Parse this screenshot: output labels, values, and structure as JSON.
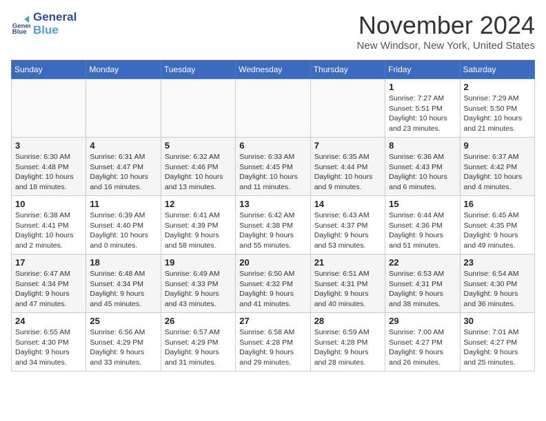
{
  "logo": {
    "line1": "General",
    "line2": "Blue"
  },
  "header": {
    "month": "November 2024",
    "location": "New Windsor, New York, United States"
  },
  "days_of_week": [
    "Sunday",
    "Monday",
    "Tuesday",
    "Wednesday",
    "Thursday",
    "Friday",
    "Saturday"
  ],
  "weeks": [
    [
      {
        "day": "",
        "info": ""
      },
      {
        "day": "",
        "info": ""
      },
      {
        "day": "",
        "info": ""
      },
      {
        "day": "",
        "info": ""
      },
      {
        "day": "",
        "info": ""
      },
      {
        "day": "1",
        "info": "Sunrise: 7:27 AM\nSunset: 5:51 PM\nDaylight: 10 hours and 23 minutes."
      },
      {
        "day": "2",
        "info": "Sunrise: 7:29 AM\nSunset: 5:50 PM\nDaylight: 10 hours and 21 minutes."
      }
    ],
    [
      {
        "day": "3",
        "info": "Sunrise: 6:30 AM\nSunset: 4:48 PM\nDaylight: 10 hours and 18 minutes."
      },
      {
        "day": "4",
        "info": "Sunrise: 6:31 AM\nSunset: 4:47 PM\nDaylight: 10 hours and 16 minutes."
      },
      {
        "day": "5",
        "info": "Sunrise: 6:32 AM\nSunset: 4:46 PM\nDaylight: 10 hours and 13 minutes."
      },
      {
        "day": "6",
        "info": "Sunrise: 6:33 AM\nSunset: 4:45 PM\nDaylight: 10 hours and 11 minutes."
      },
      {
        "day": "7",
        "info": "Sunrise: 6:35 AM\nSunset: 4:44 PM\nDaylight: 10 hours and 9 minutes."
      },
      {
        "day": "8",
        "info": "Sunrise: 6:36 AM\nSunset: 4:43 PM\nDaylight: 10 hours and 6 minutes."
      },
      {
        "day": "9",
        "info": "Sunrise: 6:37 AM\nSunset: 4:42 PM\nDaylight: 10 hours and 4 minutes."
      }
    ],
    [
      {
        "day": "10",
        "info": "Sunrise: 6:38 AM\nSunset: 4:41 PM\nDaylight: 10 hours and 2 minutes."
      },
      {
        "day": "11",
        "info": "Sunrise: 6:39 AM\nSunset: 4:40 PM\nDaylight: 10 hours and 0 minutes."
      },
      {
        "day": "12",
        "info": "Sunrise: 6:41 AM\nSunset: 4:39 PM\nDaylight: 9 hours and 58 minutes."
      },
      {
        "day": "13",
        "info": "Sunrise: 6:42 AM\nSunset: 4:38 PM\nDaylight: 9 hours and 55 minutes."
      },
      {
        "day": "14",
        "info": "Sunrise: 6:43 AM\nSunset: 4:37 PM\nDaylight: 9 hours and 53 minutes."
      },
      {
        "day": "15",
        "info": "Sunrise: 6:44 AM\nSunset: 4:36 PM\nDaylight: 9 hours and 51 minutes."
      },
      {
        "day": "16",
        "info": "Sunrise: 6:45 AM\nSunset: 4:35 PM\nDaylight: 9 hours and 49 minutes."
      }
    ],
    [
      {
        "day": "17",
        "info": "Sunrise: 6:47 AM\nSunset: 4:34 PM\nDaylight: 9 hours and 47 minutes."
      },
      {
        "day": "18",
        "info": "Sunrise: 6:48 AM\nSunset: 4:34 PM\nDaylight: 9 hours and 45 minutes."
      },
      {
        "day": "19",
        "info": "Sunrise: 6:49 AM\nSunset: 4:33 PM\nDaylight: 9 hours and 43 minutes."
      },
      {
        "day": "20",
        "info": "Sunrise: 6:50 AM\nSunset: 4:32 PM\nDaylight: 9 hours and 41 minutes."
      },
      {
        "day": "21",
        "info": "Sunrise: 6:51 AM\nSunset: 4:31 PM\nDaylight: 9 hours and 40 minutes."
      },
      {
        "day": "22",
        "info": "Sunrise: 6:53 AM\nSunset: 4:31 PM\nDaylight: 9 hours and 38 minutes."
      },
      {
        "day": "23",
        "info": "Sunrise: 6:54 AM\nSunset: 4:30 PM\nDaylight: 9 hours and 36 minutes."
      }
    ],
    [
      {
        "day": "24",
        "info": "Sunrise: 6:55 AM\nSunset: 4:30 PM\nDaylight: 9 hours and 34 minutes."
      },
      {
        "day": "25",
        "info": "Sunrise: 6:56 AM\nSunset: 4:29 PM\nDaylight: 9 hours and 33 minutes."
      },
      {
        "day": "26",
        "info": "Sunrise: 6:57 AM\nSunset: 4:29 PM\nDaylight: 9 hours and 31 minutes."
      },
      {
        "day": "27",
        "info": "Sunrise: 6:58 AM\nSunset: 4:28 PM\nDaylight: 9 hours and 29 minutes."
      },
      {
        "day": "28",
        "info": "Sunrise: 6:59 AM\nSunset: 4:28 PM\nDaylight: 9 hours and 28 minutes."
      },
      {
        "day": "29",
        "info": "Sunrise: 7:00 AM\nSunset: 4:27 PM\nDaylight: 9 hours and 26 minutes."
      },
      {
        "day": "30",
        "info": "Sunrise: 7:01 AM\nSunset: 4:27 PM\nDaylight: 9 hours and 25 minutes."
      }
    ]
  ]
}
